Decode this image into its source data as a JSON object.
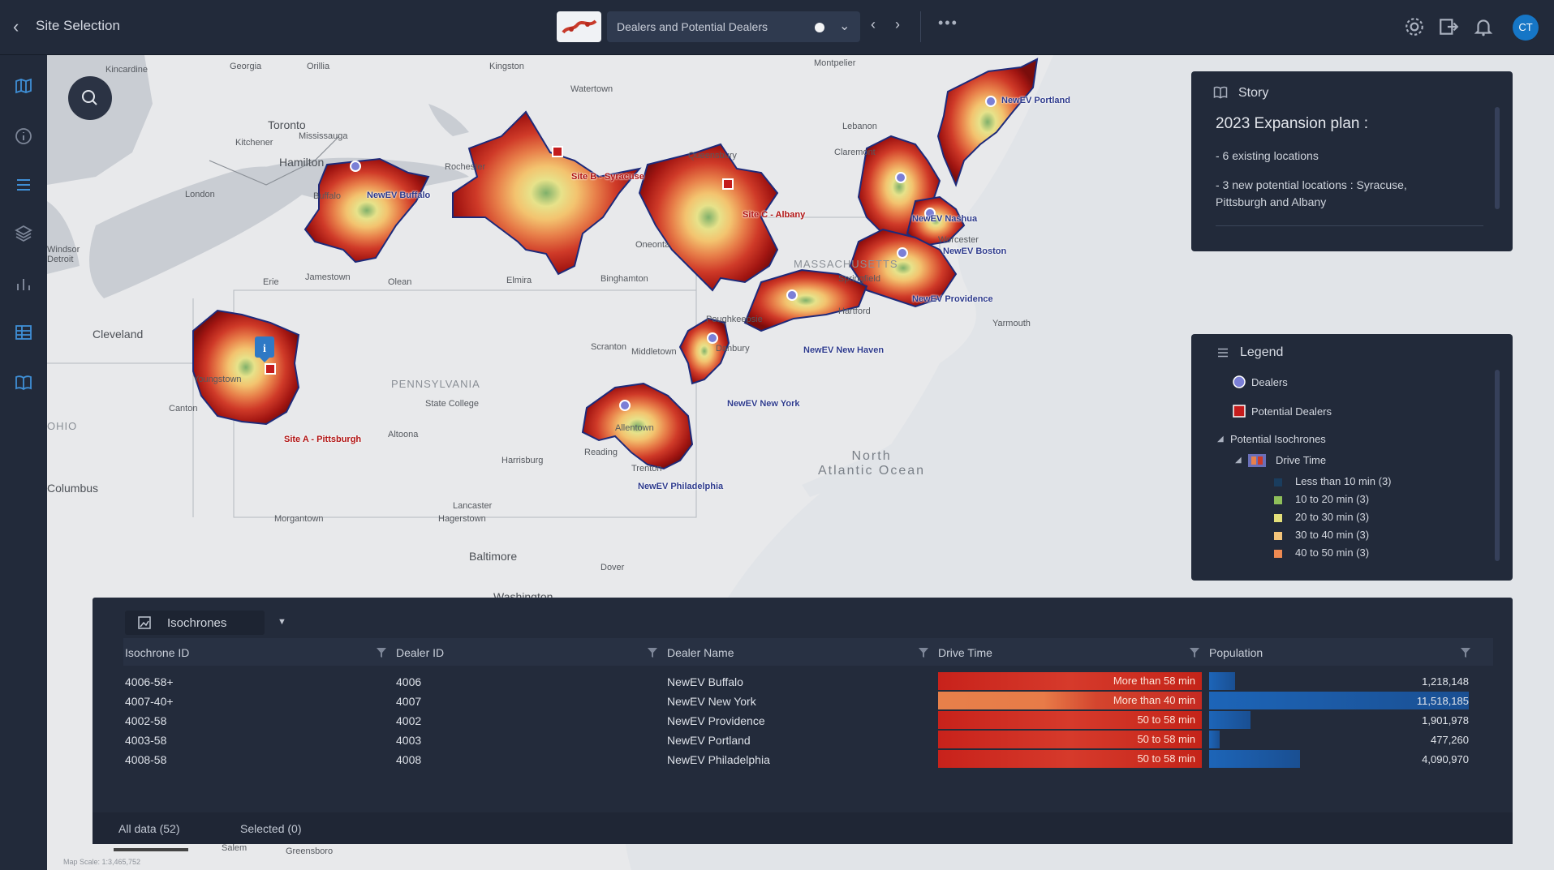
{
  "topbar": {
    "title": "Site Selection",
    "story_select": "Dealers and Potential Dealers",
    "avatar_initials": "CT"
  },
  "map": {
    "places": [
      {
        "name": "Kincardine"
      },
      {
        "name": "Georgia"
      },
      {
        "name": "Orillia"
      },
      {
        "name": "Kingston"
      },
      {
        "name": "Watertown"
      },
      {
        "name": "Montpelier"
      },
      {
        "name": "Toronto"
      },
      {
        "name": "Mississauga"
      },
      {
        "name": "Hamilton"
      },
      {
        "name": "London"
      },
      {
        "name": "Kitchener"
      },
      {
        "name": "Buffalo"
      },
      {
        "name": "Rochester"
      },
      {
        "name": "Queensbury"
      },
      {
        "name": "Lebanon"
      },
      {
        "name": "Claremont"
      },
      {
        "name": "Windsor"
      },
      {
        "name": "Detroit"
      },
      {
        "name": "Erie"
      },
      {
        "name": "Jamestown"
      },
      {
        "name": "Olean"
      },
      {
        "name": "Elmira"
      },
      {
        "name": "Binghamton"
      },
      {
        "name": "Oneonta"
      },
      {
        "name": "Springfield"
      },
      {
        "name": "Worcester"
      },
      {
        "name": "Hartford"
      },
      {
        "name": "Cleveland"
      },
      {
        "name": "Youngstown"
      },
      {
        "name": "Canton"
      },
      {
        "name": "Columbus"
      },
      {
        "name": "Scranton"
      },
      {
        "name": "Allentown"
      },
      {
        "name": "Reading"
      },
      {
        "name": "Harrisburg"
      },
      {
        "name": "Lancaster"
      },
      {
        "name": "Baltimore"
      },
      {
        "name": "Washington"
      },
      {
        "name": "Trenton"
      },
      {
        "name": "Altoona"
      },
      {
        "name": "State College"
      },
      {
        "name": "Morgantown"
      },
      {
        "name": "Salem"
      },
      {
        "name": "Greensboro"
      },
      {
        "name": "Danbury"
      },
      {
        "name": "Poughkeepsie"
      },
      {
        "name": "Middletown"
      },
      {
        "name": "Hagerstown"
      },
      {
        "name": "Dover"
      },
      {
        "name": "Yarmouth"
      }
    ],
    "states": [
      "PENNSYLVANIA",
      "MASSACHUSETTS",
      "OHIO"
    ],
    "ocean": "North\nAtlantic Ocean",
    "dealers": [
      "NewEV Portland",
      "NewEV Buffalo",
      "NewEV Nashua",
      "NewEV Boston",
      "NewEV Providence",
      "NewEV New Haven",
      "NewEV New York",
      "NewEV Philadelphia"
    ],
    "potential": [
      "Site B - Syracuse",
      "Site C - Albany",
      "Site A - Pittsburgh"
    ],
    "scale_label": "Map Scale: 1:3,465,752"
  },
  "story": {
    "title": "Story",
    "heading": "2023 Expansion plan :",
    "lines": [
      "- 6 existing locations",
      "- 3 new potential locations : Syracuse, Pittsburgh and Albany"
    ]
  },
  "legend": {
    "title": "Legend",
    "dealers": "Dealers",
    "potential_dealers": "Potential Dealers",
    "group": "Potential Isochrones",
    "subgroup": "Drive Time",
    "classes": [
      {
        "label": "Less than 10 min (3)",
        "color": "#1a3d5e"
      },
      {
        "label": "10 to 20 min (3)",
        "color": "#8fbf5a"
      },
      {
        "label": "20 to 30 min (3)",
        "color": "#e4e07a"
      },
      {
        "label": "30 to 40 min (3)",
        "color": "#f3c47a"
      },
      {
        "label": "40 to 50 min (3)",
        "color": "#ee8a52"
      }
    ]
  },
  "table": {
    "layer": "Isochrones",
    "columns": [
      "Isochrone ID",
      "Dealer ID",
      "Dealer Name",
      "Drive Time",
      "Population"
    ],
    "rows": [
      {
        "id": "4006-58+",
        "dealer_id": "4006",
        "name": "NewEV Buffalo",
        "drive": "More than 58 min",
        "population": "1,218,148",
        "pop_share": 0.1
      },
      {
        "id": "4007-40+",
        "dealer_id": "4007",
        "name": "NewEV New York",
        "drive": "More than 40 min",
        "population": "11,518,185",
        "pop_share": 1.0
      },
      {
        "id": "4002-58",
        "dealer_id": "4002",
        "name": "NewEV Providence",
        "drive": "50 to 58 min",
        "population": "1,901,978",
        "pop_share": 0.16
      },
      {
        "id": "4003-58",
        "dealer_id": "4003",
        "name": "NewEV Portland",
        "drive": "50 to 58 min",
        "population": "477,260",
        "pop_share": 0.04
      },
      {
        "id": "4008-58",
        "dealer_id": "4008",
        "name": "NewEV Philadelphia",
        "drive": "50 to 58 min",
        "population": "4,090,970",
        "pop_share": 0.35
      }
    ],
    "tabs": [
      "All data (52)",
      "Selected (0)"
    ]
  }
}
